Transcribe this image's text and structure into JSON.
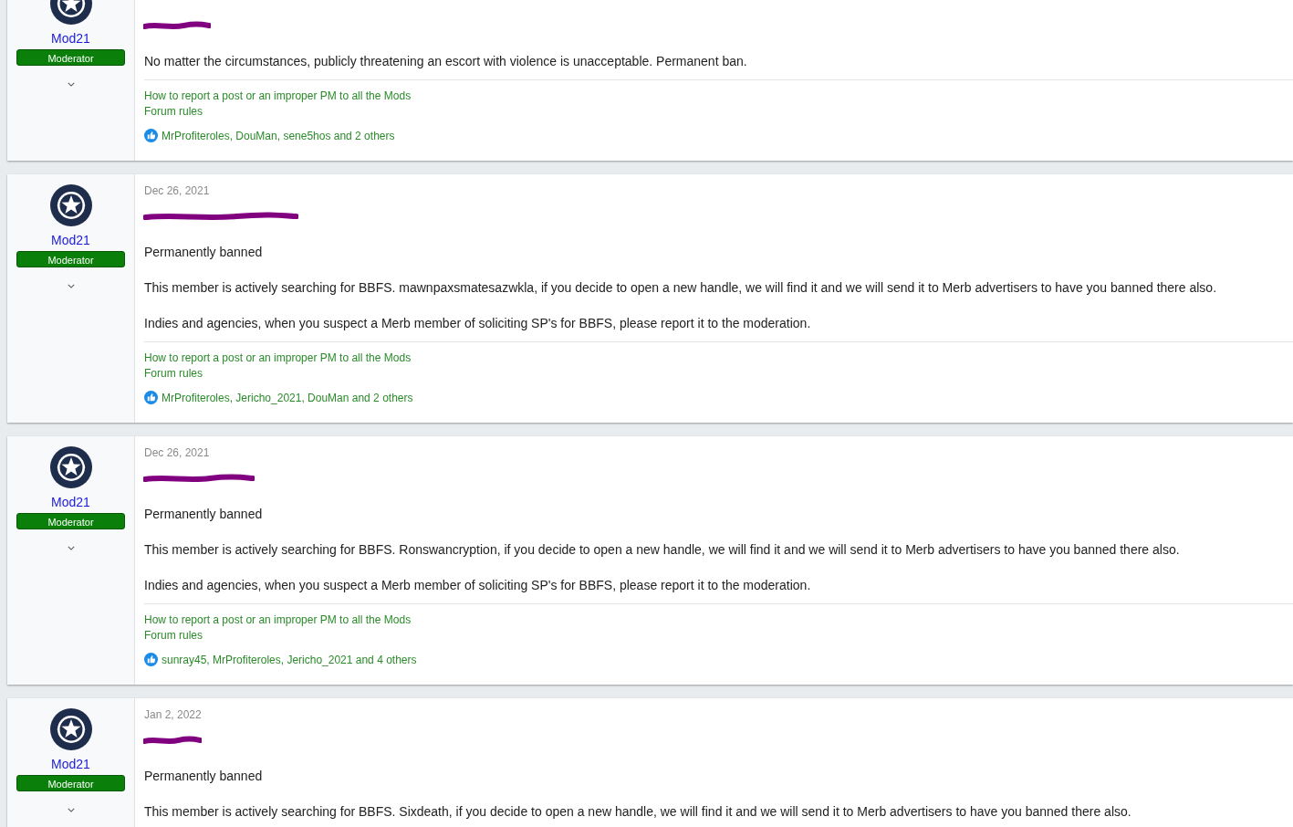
{
  "posts": [
    {
      "author": {
        "name": "Mod21",
        "badge": "Moderator"
      },
      "handle": {
        "redacted": true
      },
      "paragraphs": [
        "No matter the circumstances, publicly threatening an escort with violence is unacceptable. Permanent ban."
      ],
      "signature": [
        "How to report a post or an improper PM to all the Mods",
        "Forum rules"
      ],
      "reactions": "MrProfiteroles, DouMan, sene5hos and 2 others"
    },
    {
      "author": {
        "name": "Mod21",
        "badge": "Moderator"
      },
      "date": "Dec 26, 2021",
      "handle": {
        "redacted": true
      },
      "paragraphs": [
        "Permanently banned",
        "This member is actively searching for BBFS. mawnpaxsmatesazwkla, if you decide to open a new handle, we will find it and we will send it to Merb advertisers to have you banned there also.",
        "Indies and agencies, when you suspect a Merb member of soliciting SP's for BBFS, please report it to the moderation."
      ],
      "signature": [
        "How to report a post or an improper PM to all the Mods",
        "Forum rules"
      ],
      "reactions": "MrProfiteroles, Jericho_2021, DouMan and 2 others"
    },
    {
      "author": {
        "name": "Mod21",
        "badge": "Moderator"
      },
      "date": "Dec 26, 2021",
      "handle": {
        "redacted": true
      },
      "paragraphs": [
        "Permanently banned",
        "This member is actively searching for BBFS. Ronswancryption, if you decide to open a new handle, we will find it and we will send it to Merb advertisers to have you banned there also.",
        "Indies and agencies, when you suspect a Merb member of soliciting SP's for BBFS, please report it to the moderation."
      ],
      "signature": [
        "How to report a post or an improper PM to all the Mods",
        "Forum rules"
      ],
      "reactions": "sunray45, MrProfiteroles, Jericho_2021 and 4 others"
    },
    {
      "author": {
        "name": "Mod21",
        "badge": "Moderator"
      },
      "date": "Jan 2, 2022",
      "handle": {
        "redacted": true
      },
      "paragraphs": [
        "Permanently banned",
        "This member is actively searching for BBFS. Sixdeath, if you decide to open a new handle, we will find it and we will send it to Merb advertisers to have you banned there also."
      ]
    }
  ]
}
